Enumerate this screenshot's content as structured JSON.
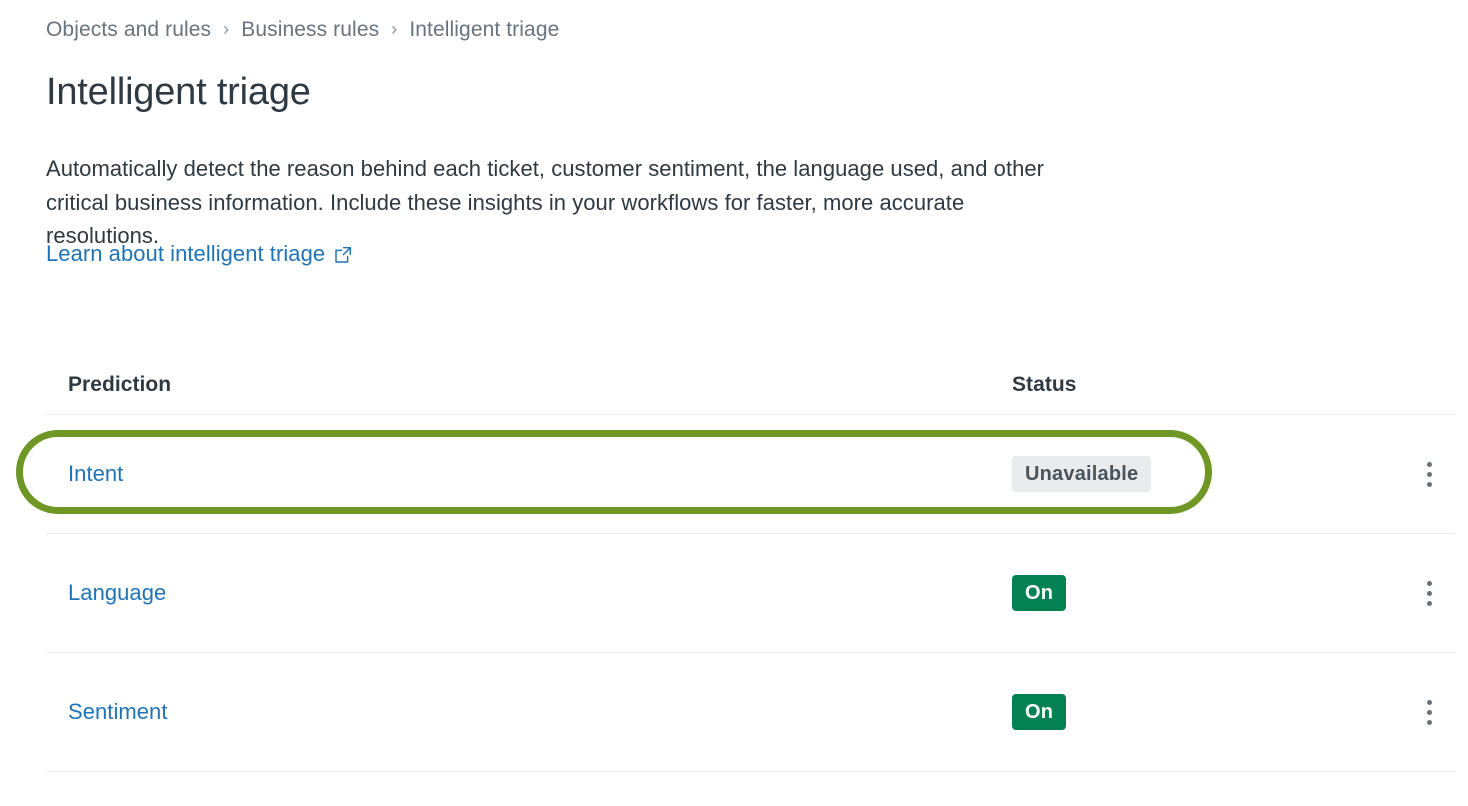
{
  "breadcrumb": {
    "items": [
      {
        "label": "Objects and rules",
        "current": false
      },
      {
        "label": "Business rules",
        "current": false
      },
      {
        "label": "Intelligent triage",
        "current": true
      }
    ],
    "separator": "›"
  },
  "header": {
    "title": "Intelligent triage",
    "description": "Automatically detect the reason behind each ticket, customer sentiment, the language used, and other critical business information. Include these insights in your workflows for faster, more accurate resolutions.",
    "learn_link_label": "Learn about intelligent triage",
    "learn_link_icon": "external-link-icon"
  },
  "table": {
    "columns": [
      {
        "key": "prediction",
        "label": "Prediction"
      },
      {
        "key": "status",
        "label": "Status"
      }
    ],
    "rows": [
      {
        "prediction": "Intent",
        "status": "Unavailable",
        "status_variant": "grey",
        "actions_icon": "kebab-menu-icon",
        "highlighted": true
      },
      {
        "prediction": "Language",
        "status": "On",
        "status_variant": "green",
        "actions_icon": "kebab-menu-icon",
        "highlighted": false
      },
      {
        "prediction": "Sentiment",
        "status": "On",
        "status_variant": "green",
        "actions_icon": "kebab-menu-icon",
        "highlighted": false
      }
    ]
  },
  "annotation": {
    "target_row": "Intent",
    "color": "#6f9726",
    "shape": "rounded-rectangle-outline"
  },
  "colors": {
    "link": "#1f73b7",
    "text": "#2f3941",
    "muted": "#68737d",
    "divider": "#e9ebed",
    "badge_grey_bg": "#e9ebed",
    "badge_grey_text": "#49545c",
    "badge_green_bg": "#038153",
    "badge_green_text": "#ffffff",
    "annotation_green": "#6f9726"
  }
}
